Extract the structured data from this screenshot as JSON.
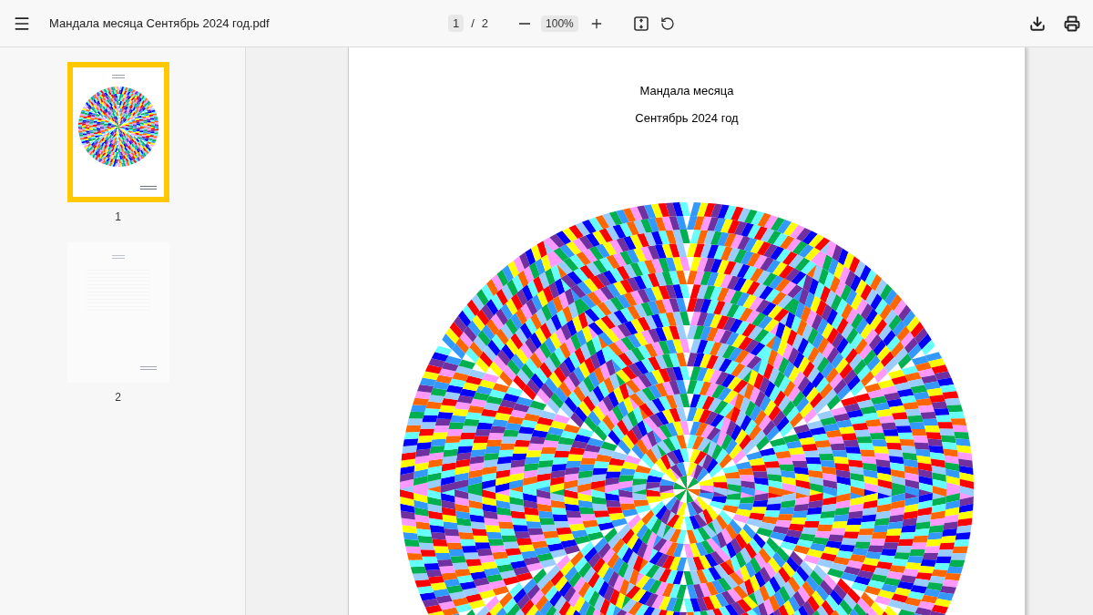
{
  "toolbar": {
    "title": "Мандала месяца Сентябрь 2024 год.pdf",
    "page_current": "1",
    "page_separator": "/",
    "page_total": "2",
    "zoom": "100%"
  },
  "thumbnails": [
    {
      "label": "1",
      "selected": true,
      "kind": "mandala"
    },
    {
      "label": "2",
      "selected": false,
      "kind": "text"
    }
  ],
  "page": {
    "heading": "Мандала месяца",
    "subheading": "Сентябрь 2024 год"
  }
}
